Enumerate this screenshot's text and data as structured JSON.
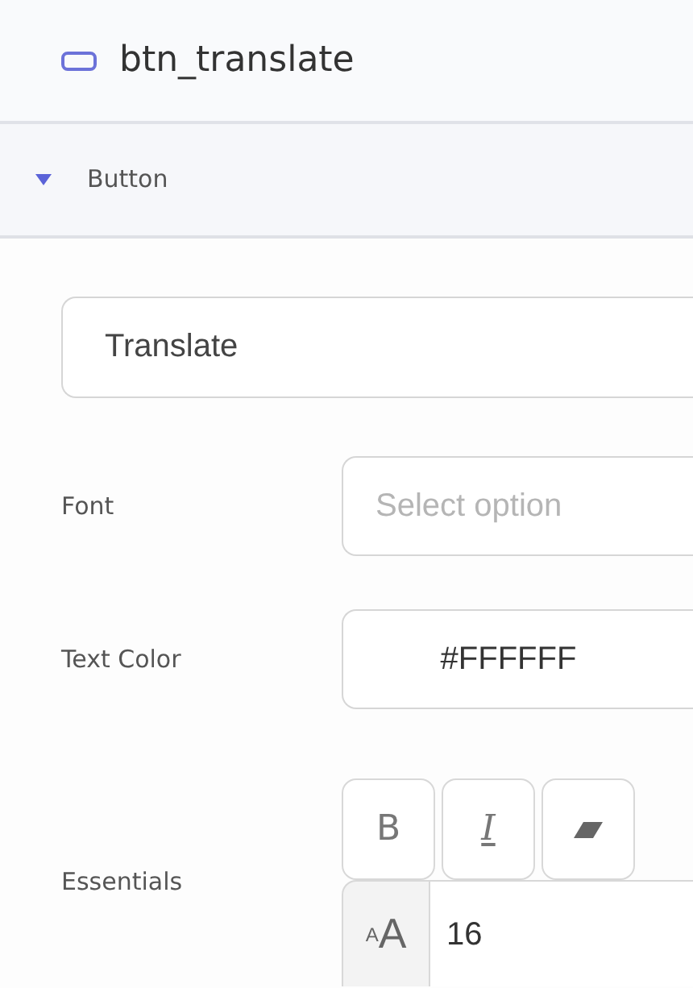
{
  "header": {
    "title": "btn_translate"
  },
  "section": {
    "title": "Button",
    "expanded": true
  },
  "text_field": {
    "value": "Translate"
  },
  "rows": [
    {
      "kind": "select",
      "label": "Font",
      "placeholder": "Select option"
    },
    {
      "kind": "color",
      "label": "Text Color",
      "value": "#FFFFFF"
    },
    {
      "kind": "essentials",
      "label": "Essentials",
      "buttons": [
        {
          "kind": "bold",
          "label": "B",
          "on": false
        },
        {
          "kind": "italic",
          "label": "I",
          "on": false
        },
        {
          "kind": "clear"
        }
      ],
      "size_prefix": "$_{A}$A",
      "size": "16"
    }
  ]
}
